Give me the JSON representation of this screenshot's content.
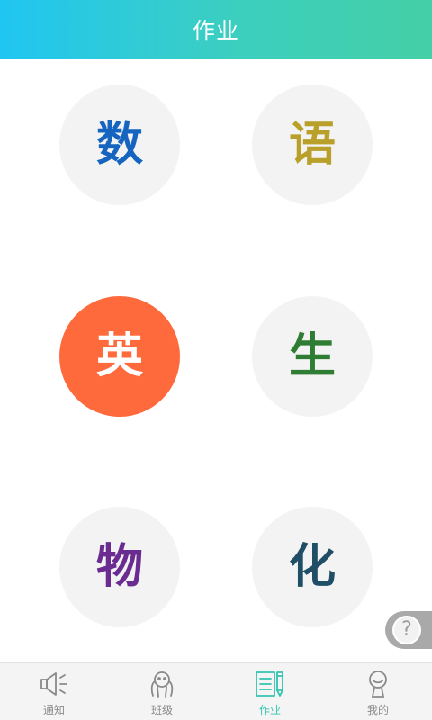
{
  "header": {
    "title": "作业"
  },
  "subjects": [
    {
      "label": "数",
      "color": "#1565c0"
    },
    {
      "label": "语",
      "color": "#b8a02a"
    },
    {
      "label": "英",
      "color": "#ffffff",
      "bg": "#ff6a3d"
    },
    {
      "label": "生",
      "color": "#2e7d32"
    },
    {
      "label": "物",
      "color": "#6a2c91"
    },
    {
      "label": "化",
      "color": "#1f4e66"
    }
  ],
  "help": {
    "label": "?"
  },
  "tabbar": {
    "active_index": 2,
    "active_color": "#33c4b1",
    "items": [
      {
        "label": "通知",
        "icon": "speaker-icon"
      },
      {
        "label": "班级",
        "icon": "class-people-icon"
      },
      {
        "label": "作业",
        "icon": "homework-notebook-icon"
      },
      {
        "label": "我的",
        "icon": "profile-person-icon"
      }
    ]
  }
}
